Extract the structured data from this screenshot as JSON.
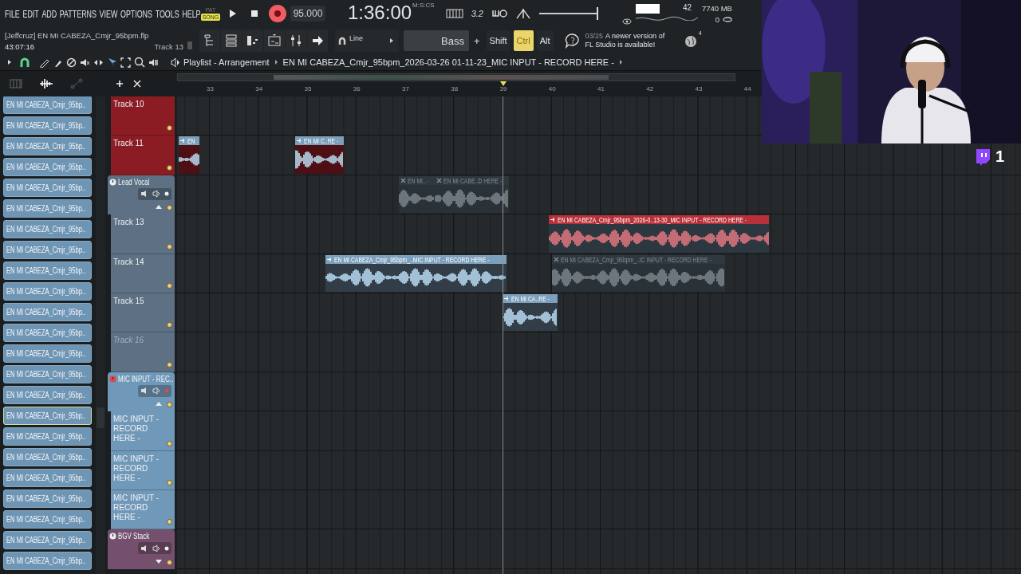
{
  "menu": [
    "FILE",
    "EDIT",
    "ADD",
    "PATTERNS",
    "VIEW",
    "OPTIONS",
    "TOOLS",
    "HELP"
  ],
  "mode": [
    {
      "label": "PAT",
      "selected": false
    },
    {
      "label": "SONG",
      "selected": true
    }
  ],
  "tempo": "95.000",
  "time": {
    "value": "1:36:00",
    "unit": "M:S:CS"
  },
  "countdown": "3.2",
  "master_volume": {
    "level": 1
  },
  "cpu": "42",
  "memory": "7740 MB",
  "polyphony": "0",
  "project": {
    "file": "[Jeffcruz] EN MI CABEZA_Cmjr_95bpm.flp",
    "elapsed": "43:07:16",
    "focus": "Track 13"
  },
  "snap": "Line",
  "preset": "Bass",
  "preset_add": "+",
  "modifiers": [
    {
      "label": "Shift",
      "on": false
    },
    {
      "label": "Ctrl",
      "on": true
    },
    {
      "label": "Alt",
      "on": false
    }
  ],
  "hint": {
    "date": "03/25",
    "text": "A newer version of FL Studio is available!"
  },
  "news_count": "4",
  "playlist": {
    "title": "Playlist - Arrangement",
    "path": "EN MI CABEZA_Cmjr_95bpm_2026-03-26 01-11-23_MIC INPUT - RECORD HERE -",
    "bars": [
      "33",
      "34",
      "35",
      "36",
      "37",
      "38",
      "39",
      "40",
      "41",
      "42",
      "43",
      "44"
    ],
    "tracks": [
      {
        "kind": "track",
        "name": "Track 10",
        "color": "#8c1c24",
        "disabled": false
      },
      {
        "kind": "track",
        "name": "Track 11",
        "color": "#8c1c24",
        "disabled": false,
        "clips": [
          {
            "label": "EN",
            "selected": false,
            "muted": false
          },
          {
            "label": "EN MI C..RE -",
            "selected": false,
            "muted": false
          }
        ]
      },
      {
        "kind": "group",
        "name": "Lead Vocal",
        "color": "#5d7084",
        "armed": false,
        "expanded": true,
        "clips": [
          {
            "label": "EN MI.. -",
            "selected": false,
            "muted": true
          },
          {
            "label": "EN MI CABE..D HERE -",
            "selected": false,
            "muted": true
          }
        ]
      },
      {
        "kind": "track",
        "name": "Track 13",
        "color": "#5d7084",
        "disabled": false,
        "clips": [
          {
            "label": "EN MI CABEZA_Cmjr_95bpm_2026-0..13-30_MIC INPUT - RECORD HERE -",
            "selected": true,
            "muted": false
          }
        ]
      },
      {
        "kind": "track",
        "name": "Track 14",
        "color": "#5d7084",
        "disabled": false,
        "clips": [
          {
            "label": "EN MI CABEZA_Cmjr_95bpm_..MIC INPUT - RECORD HERE -",
            "selected": false,
            "muted": false
          },
          {
            "label": "EN MI CABEZA_Cmjr_95bpm_..IC INPUT - RECORD HERE -",
            "selected": false,
            "muted": true
          }
        ]
      },
      {
        "kind": "track",
        "name": "Track 15",
        "color": "#5d7084",
        "disabled": false,
        "clips": [
          {
            "label": "EN MI CA..RE -",
            "selected": false,
            "muted": false
          }
        ]
      },
      {
        "kind": "track",
        "name": "Track 16",
        "color": "#5d7084",
        "disabled": true
      },
      {
        "kind": "group",
        "name": "MIC INPUT - REC..",
        "color": "#7098b9",
        "armed": true,
        "expanded": true
      },
      {
        "kind": "track",
        "name": "MIC INPUT - RECORD HERE -",
        "color": "#7098b9",
        "disabled": false
      },
      {
        "kind": "track",
        "name": "MIC INPUT - RECORD HERE -",
        "color": "#7098b9",
        "disabled": false
      },
      {
        "kind": "track",
        "name": "MIC INPUT - RECORD HERE -",
        "color": "#7098b9",
        "disabled": false
      },
      {
        "kind": "group",
        "name": "BGV Stack",
        "color": "#74506e",
        "armed": false,
        "expanded": false
      }
    ]
  },
  "picker": [
    {
      "label": "EN MI CABEZA_Cmjr_95bp..",
      "selected": false
    },
    {
      "label": "EN MI CABEZA_Cmjr_95bp..",
      "selected": false
    },
    {
      "label": "EN MI CABEZA_Cmjr_95bp..",
      "selected": false
    },
    {
      "label": "EN MI CABEZA_Cmjr_95bp..",
      "selected": false
    },
    {
      "label": "EN MI CABEZA_Cmjr_95bp..",
      "selected": false
    },
    {
      "label": "EN MI CABEZA_Cmjr_95bp..",
      "selected": false
    },
    {
      "label": "EN MI CABEZA_Cmjr_95bp..",
      "selected": false
    },
    {
      "label": "EN MI CABEZA_Cmjr_95bp..",
      "selected": false
    },
    {
      "label": "EN MI CABEZA_Cmjr_95bp..",
      "selected": false
    },
    {
      "label": "EN MI CABEZA_Cmjr_95bp..",
      "selected": false
    },
    {
      "label": "EN MI CABEZA_Cmjr_95bp..",
      "selected": false
    },
    {
      "label": "EN MI CABEZA_Cmjr_95bp..",
      "selected": false
    },
    {
      "label": "EN MI CABEZA_Cmjr_95bp..",
      "selected": false
    },
    {
      "label": "EN MI CABEZA_Cmjr_95bp..",
      "selected": false
    },
    {
      "label": "EN MI CABEZA_Cmjr_95bp..",
      "selected": false
    },
    {
      "label": "EN MI CABEZA_Cmjr_95bp..",
      "selected": true
    },
    {
      "label": "EN MI CABEZA_Cmjr_95bp..",
      "selected": false
    },
    {
      "label": "EN MI CABEZA_Cmjr_95bp..",
      "selected": false
    },
    {
      "label": "EN MI CABEZA_Cmjr_95bp..",
      "selected": false
    },
    {
      "label": "EN MI CABEZA_Cmjr_95bp..",
      "selected": false
    },
    {
      "label": "EN MI CABEZA_Cmjr_95bp..",
      "selected": false
    },
    {
      "label": "EN MI CABEZA_Cmjr_95bp..",
      "selected": false
    },
    {
      "label": "EN MI CABEZA_Cmjr_95bp..",
      "selected": false
    }
  ],
  "stream": {
    "viewers": "1"
  }
}
